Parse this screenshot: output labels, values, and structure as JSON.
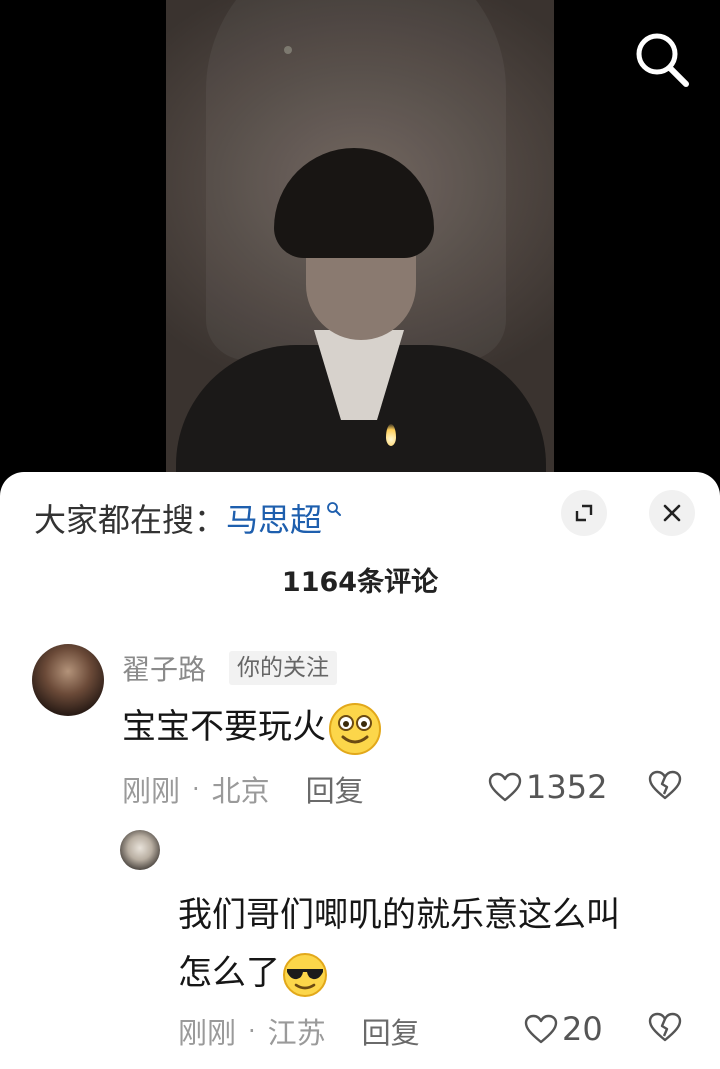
{
  "header": {
    "search_prefix": "大家都在搜：",
    "search_keyword": "马思超"
  },
  "comment_count": "1164条评论",
  "comments": [
    {
      "username": "翟子路",
      "tag": "你的关注",
      "text": "宝宝不要玩火",
      "emoji": "grinning-face",
      "time": "刚刚",
      "location": "北京",
      "reply_label": "回复",
      "likes": "1352"
    },
    {
      "username": "",
      "text_line1": "我们哥们唧叽的就乐意这么叫",
      "text_line2": "怎么了",
      "emoji": "sunglasses-face",
      "time": "刚刚",
      "location": "江苏",
      "reply_label": "回复",
      "likes": "20"
    }
  ],
  "icons": {
    "search": "search-icon",
    "expand": "expand-icon",
    "close": "close-icon",
    "heart": "heart-icon",
    "dislike": "broken-heart-icon"
  },
  "colors": {
    "keyword": "#1e5fae",
    "sheet_bg": "#ffffff",
    "video_bg": "#000000"
  }
}
